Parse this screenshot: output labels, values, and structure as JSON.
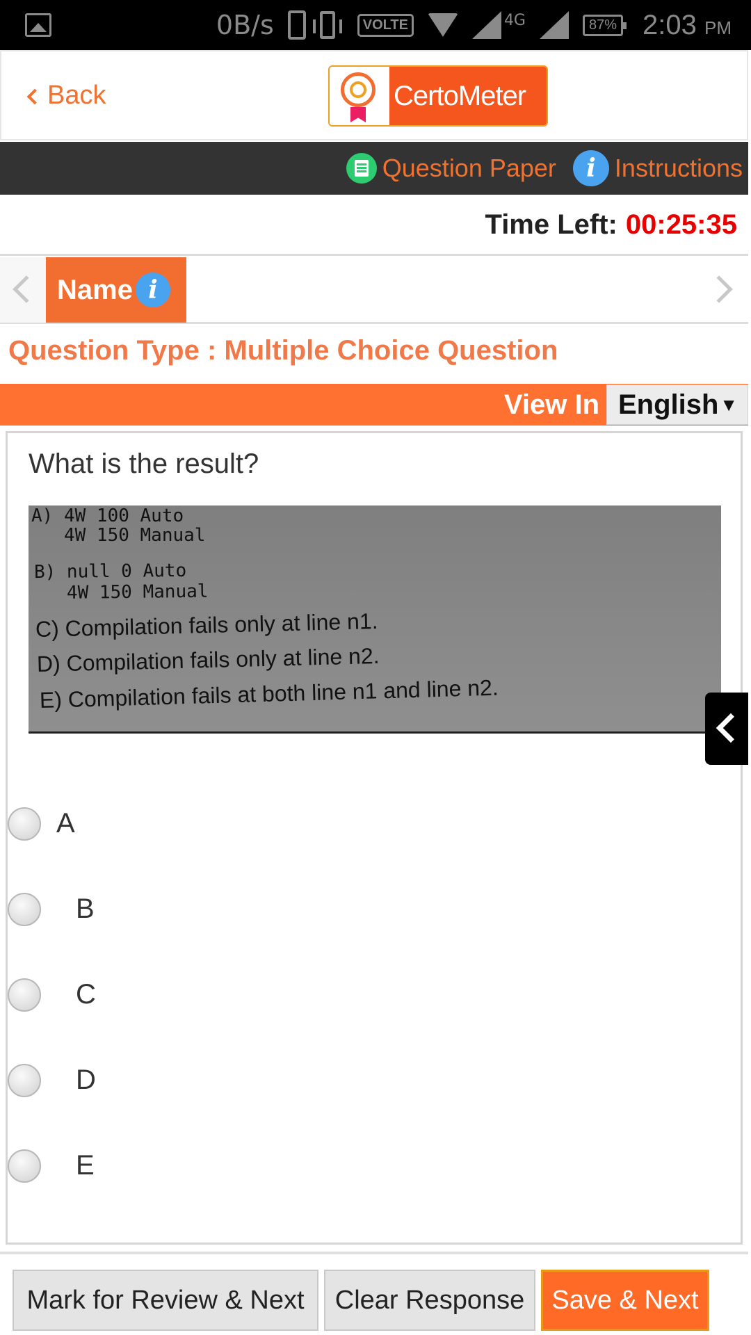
{
  "status_bar": {
    "net_speed": "0B/s",
    "volte": "VOLTE",
    "network": "4G",
    "battery": "87%",
    "time": "2:03",
    "ampm": "PM"
  },
  "header": {
    "back_label": "Back",
    "logo_text": "CertoMeter"
  },
  "nav": {
    "question_paper": "Question Paper",
    "instructions": "Instructions",
    "info_glyph": "i"
  },
  "timer": {
    "label": "Time Left:",
    "value": "00:25:35"
  },
  "section": {
    "name": "Name"
  },
  "question": {
    "type_label": "Question Type : Multiple Choice Question",
    "view_in_label": "View In",
    "language": "English",
    "text": "What is the result?",
    "image_lines": [
      "A) 4W 100 Auto",
      "   4W 150 Manual",
      "B) null 0 Auto",
      "   4W 150 Manual",
      "C) Compilation fails only at line n1.",
      "D) Compilation fails only at line n2.",
      "E) Compilation fails at both line n1 and line n2."
    ],
    "options": [
      "A",
      "B",
      "C",
      "D",
      "E"
    ],
    "selected": null
  },
  "actions": {
    "mark_review": "Mark for Review & Next",
    "clear": "Clear Response",
    "save": "Save & Next"
  },
  "colors": {
    "accent": "#f26d30",
    "timer": "#e60000",
    "nav_bg": "#333333",
    "info_blue": "#4aa3ef",
    "qp_green": "#2ecc71"
  },
  "icons": {
    "status_gallery": "image-icon",
    "back": "chevron-left-icon",
    "question_paper": "document-list-icon",
    "instructions": "info-icon",
    "prev_section": "chevron-left-icon",
    "next_section": "chevron-right-icon",
    "side_panel": "chevron-left-icon"
  }
}
